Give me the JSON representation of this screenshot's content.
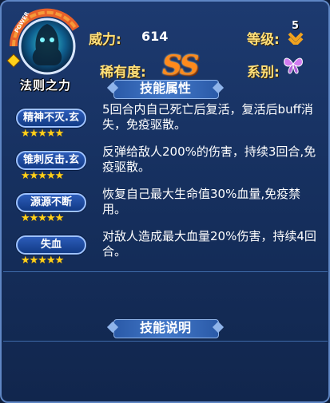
{
  "header": {
    "name": "法则之力",
    "badge_text": "POWER",
    "power_label": "威力:",
    "power_value": "614",
    "level_label": "等级:",
    "level_value": "5",
    "rarity_label": "稀有度:",
    "rarity_value": "SS",
    "type_label": "系别:",
    "type_icon": "butterfly-icon"
  },
  "sections": {
    "attributes_title": "技能属性",
    "description_title": "技能说明"
  },
  "skills": [
    {
      "name": "精神不灭.玄",
      "stars": 5,
      "stars_text": "★★★★★",
      "description": "5回合内自己死亡后复活，复活后buff消失，免疫驱散。"
    },
    {
      "name": "锥刺反击.玄",
      "stars": 5,
      "stars_text": "★★★★★",
      "description": "反弹给敌人200%的伤害，持续3回合,免疫驱散。"
    },
    {
      "name": "源源不断",
      "stars": 5,
      "stars_text": "★★★★★",
      "description": "恢复自己最大生命值30%血量,免疫禁用。"
    },
    {
      "name": "失血",
      "stars": 5,
      "stars_text": "★★★★★",
      "description": "对敌人造成最大血量20%伤害，持续4回合。"
    }
  ],
  "colors": {
    "accent_gold": "#ffe07a",
    "rarity_orange": "#ff8a1c",
    "panel_blue": "#1d3a70"
  }
}
